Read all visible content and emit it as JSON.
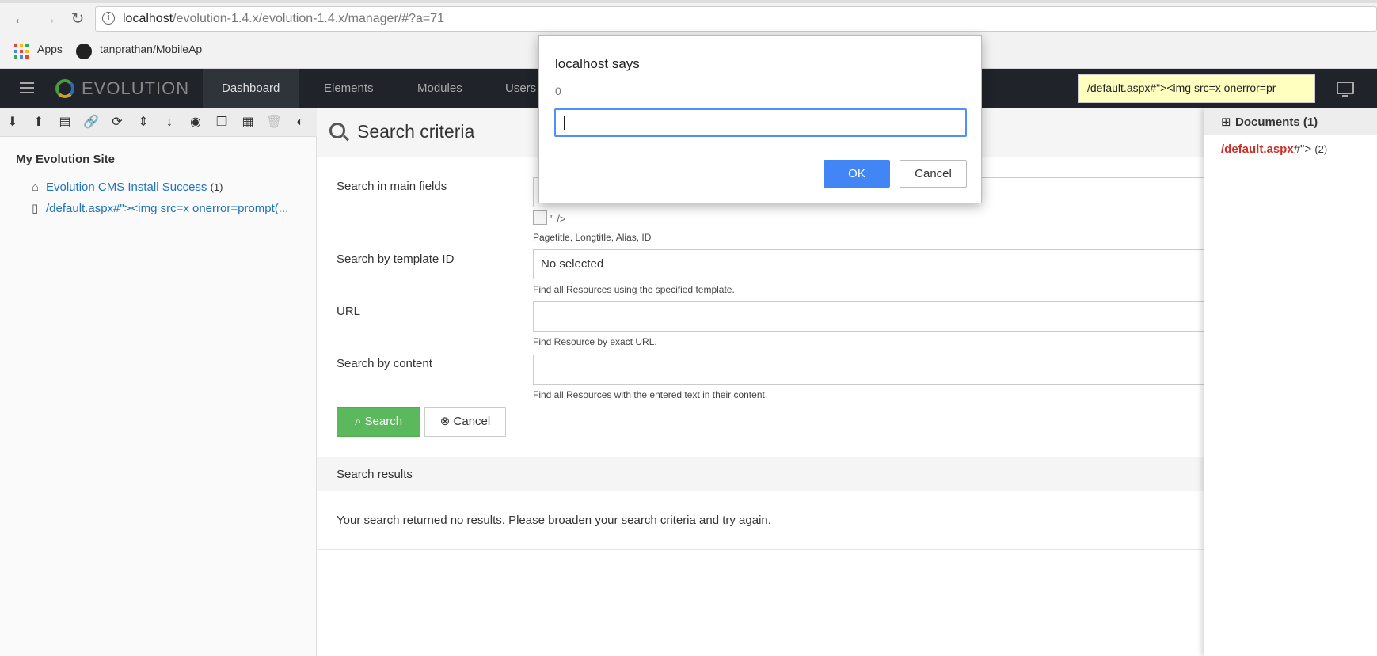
{
  "browser": {
    "url_host": "localhost",
    "url_path": "/evolution-1.4.x/evolution-1.4.x/manager/#?a=71",
    "back_icon": "←",
    "forward_icon": "→",
    "reload_icon": "↻",
    "info_icon": "i",
    "bookmarks": [
      {
        "label": "Apps"
      },
      {
        "label": "tanprathan/MobileAp"
      }
    ]
  },
  "header": {
    "logo_text": "EVOLUTION",
    "menu": [
      {
        "label": "Dashboard"
      },
      {
        "label": "Elements"
      },
      {
        "label": "Modules"
      },
      {
        "label": "Users"
      }
    ],
    "search_value": "/default.aspx#\"><img src=x onerror=pr"
  },
  "tree": {
    "toolbar_icons": [
      "expand-icon",
      "collapse-icon",
      "new-document-icon",
      "new-weblink-icon",
      "refresh-icon",
      "sort-icon",
      "sort-order-icon",
      "camera-icon",
      "copy-icon",
      "grid-icon",
      "trash-icon",
      "contrast-icon"
    ],
    "toolbar_glyphs": [
      "⬇",
      "⬆",
      "▤",
      "🔗",
      "⟳",
      "⇕",
      "↓",
      "◉",
      "❐",
      "▦",
      "🗑",
      "◐"
    ],
    "root_label": "My Evolution Site",
    "nodes": [
      {
        "label": "Evolution CMS Install Success",
        "count": "(1)",
        "icon": "⌂"
      },
      {
        "label": "/default.aspx#\"><img src=x onerror=prompt(...",
        "count": "",
        "icon": "▯"
      }
    ]
  },
  "main": {
    "title": "Search criteria",
    "fields": [
      {
        "label": "Search in main fields",
        "value": "",
        "hint": "Pagetitle, Longtitle, Alias, ID"
      },
      {
        "label": "Search by template ID",
        "value": "No selected",
        "hint": "Find all Resources using the specified template."
      },
      {
        "label": "URL",
        "value": "",
        "hint": "Find Resource by exact URL."
      },
      {
        "label": "Search by content",
        "value": "",
        "hint": "Find all Resources with the entered text in their content."
      }
    ],
    "broken_image_text": "\" />",
    "search_button": "Search",
    "cancel_button": "Cancel",
    "results_title": "Search results",
    "results_text": "Your search returned no results. Please broaden your search criteria and try again."
  },
  "right_panel": {
    "title": "Documents (1)",
    "item_red": "/default.aspx",
    "item_rest": "#\">",
    "item_count": "(2)"
  },
  "dialog": {
    "title": "localhost says",
    "message": "0",
    "input_value": "",
    "ok_label": "OK",
    "cancel_label": "Cancel"
  },
  "colors": {
    "header_bg": "#202329",
    "search_green": "#5cb85c",
    "link_blue": "#1e73be",
    "dialog_blue": "#4285f4",
    "red_text": "#c9302c"
  }
}
